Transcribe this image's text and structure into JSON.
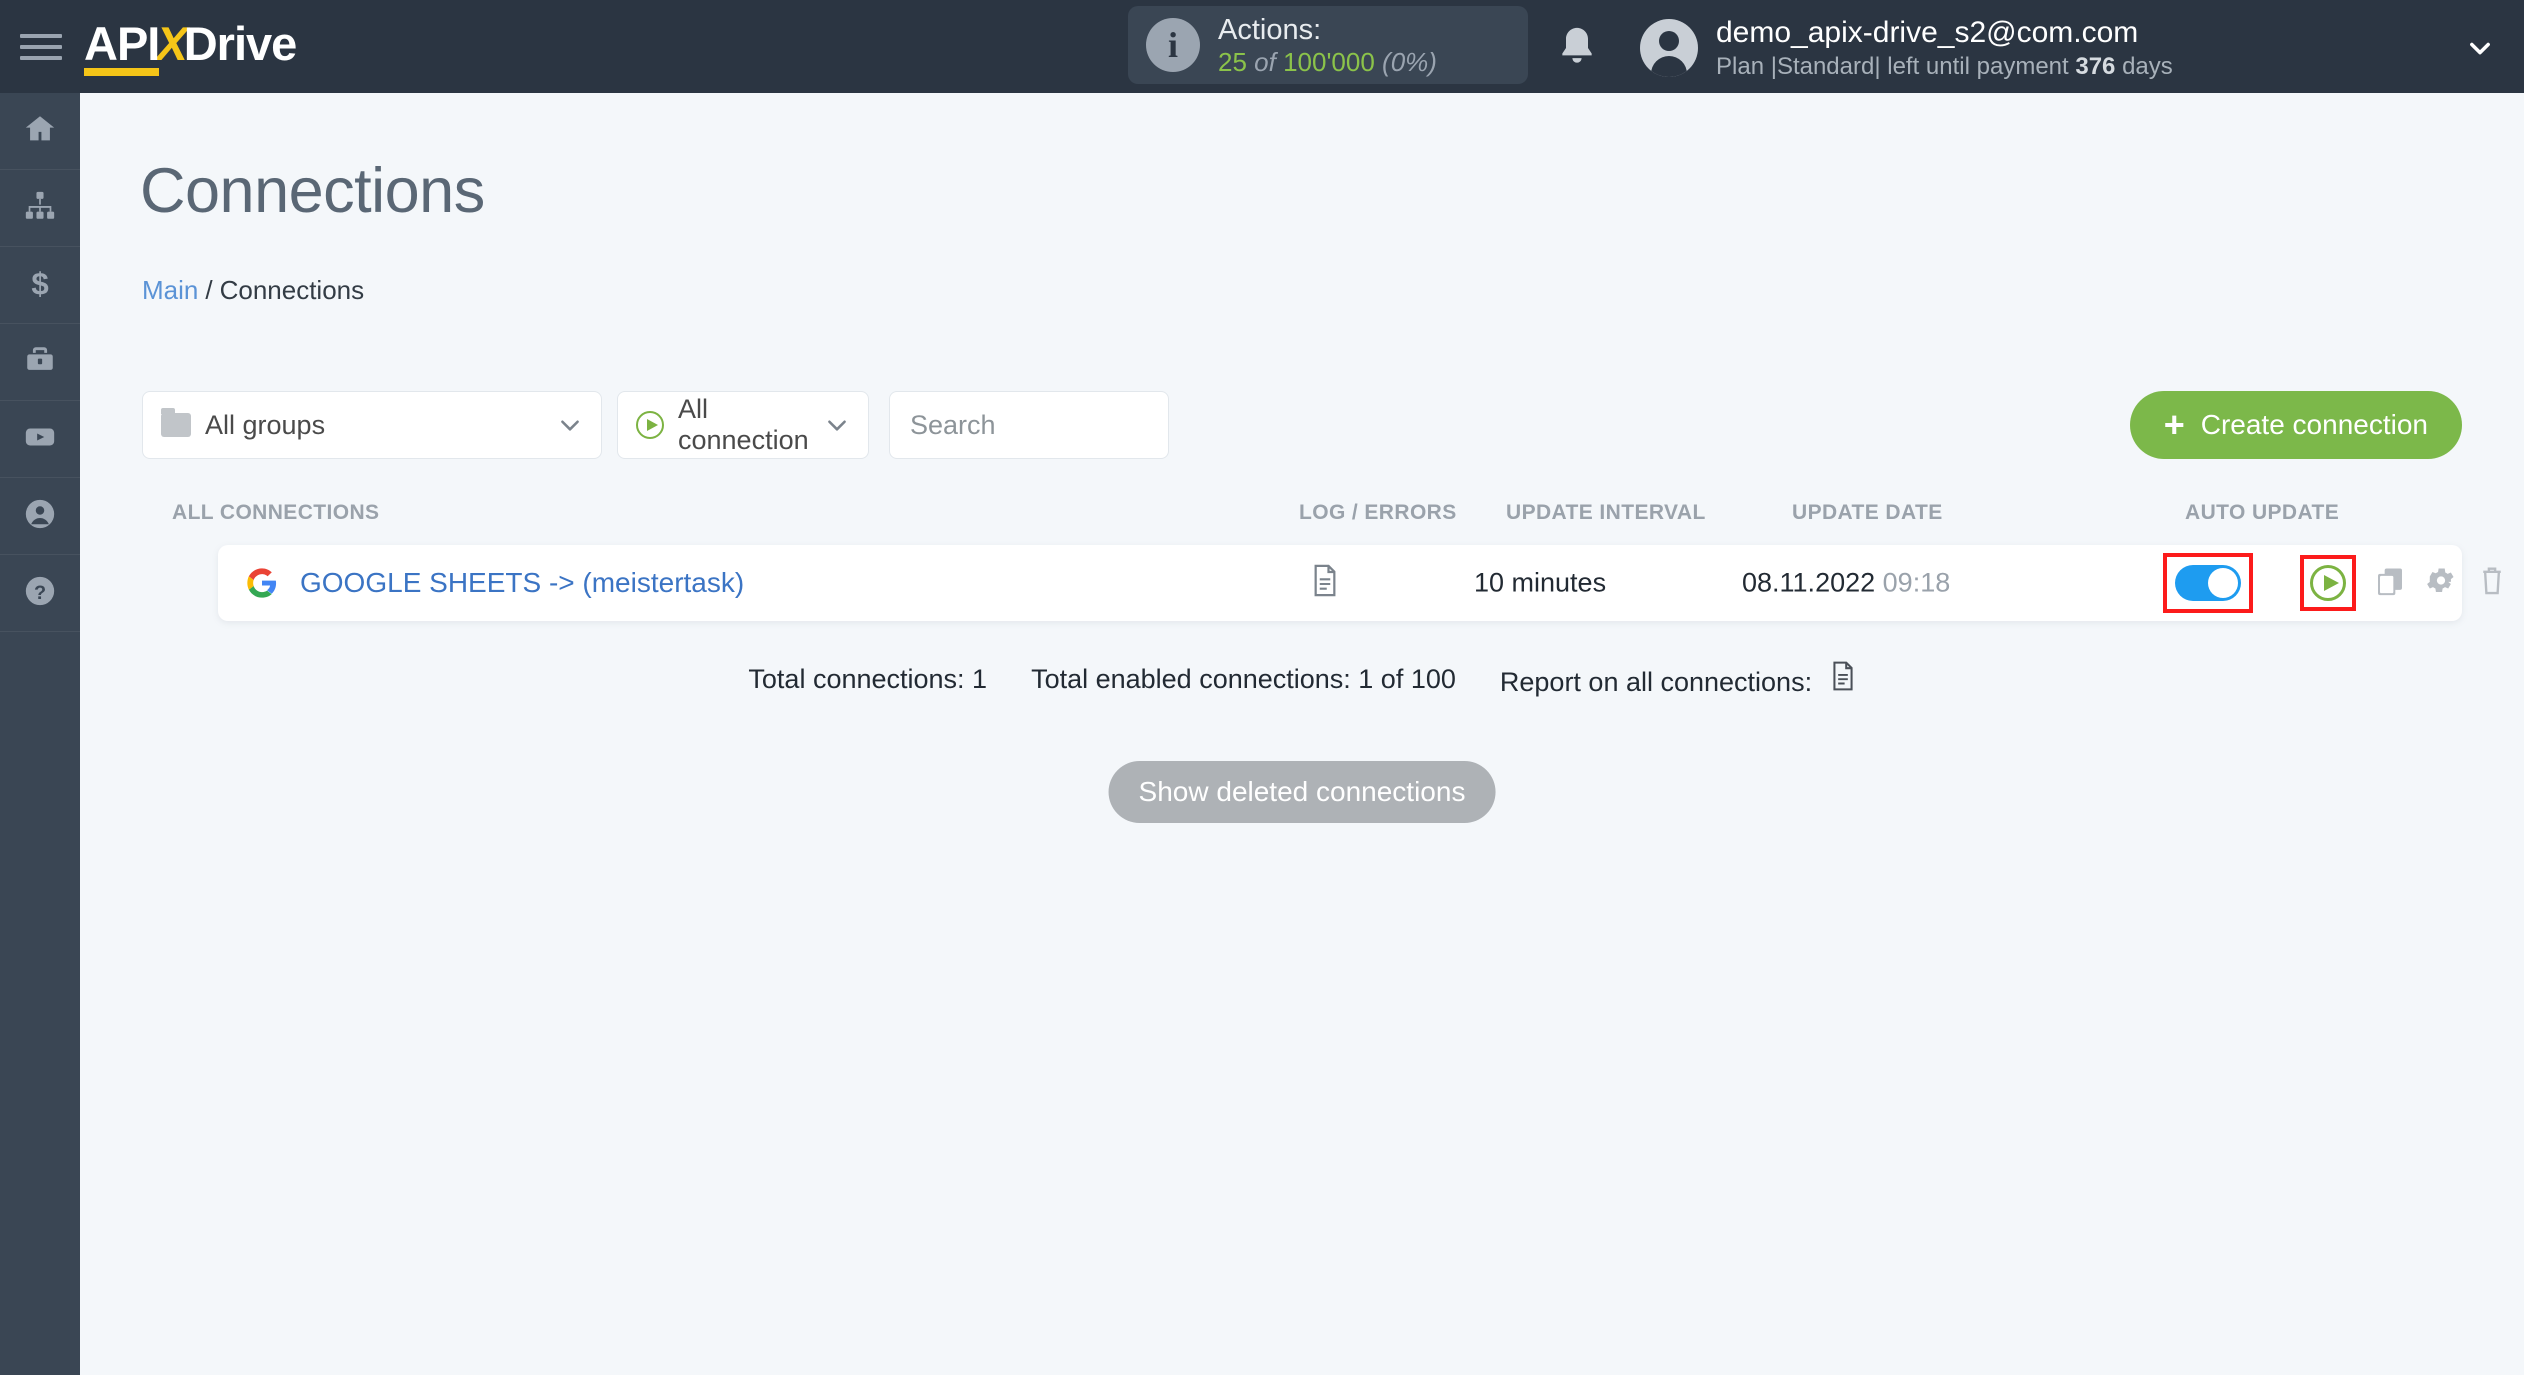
{
  "header": {
    "logo": {
      "part1": "API",
      "part2": "X",
      "part3": "Drive"
    },
    "menu_icon": "hamburger-icon",
    "actions": {
      "label": "Actions:",
      "used": "25",
      "of": "of",
      "total": "100'000",
      "percent": "(0%)"
    },
    "account": {
      "email": "demo_apix-drive_s2@com.com",
      "plan_prefix": "Plan |Standard| left until payment",
      "days_value": "376",
      "days_suffix": "days"
    }
  },
  "sidebar": {
    "items": [
      {
        "name": "home",
        "icon": "home-icon"
      },
      {
        "name": "connections",
        "icon": "sitemap-icon"
      },
      {
        "name": "billing",
        "icon": "dollar-icon"
      },
      {
        "name": "business",
        "icon": "briefcase-icon"
      },
      {
        "name": "video",
        "icon": "youtube-icon"
      },
      {
        "name": "account",
        "icon": "user-circle-icon"
      },
      {
        "name": "help",
        "icon": "question-circle-icon"
      }
    ]
  },
  "page": {
    "title": "Connections",
    "breadcrumb": {
      "root": "Main",
      "separator": "/",
      "current": "Connections"
    }
  },
  "filters": {
    "group_select": {
      "value": "All groups",
      "icon": "folder-icon"
    },
    "connection_select": {
      "value": "All connection",
      "icon": "play-circle-icon"
    },
    "search": {
      "placeholder": "Search",
      "value": ""
    },
    "create_button": {
      "label": "Create connection",
      "icon": "plus-icon"
    }
  },
  "table": {
    "columns": {
      "name": "ALL CONNECTIONS",
      "log": "LOG / ERRORS",
      "interval": "UPDATE INTERVAL",
      "date": "UPDATE DATE",
      "auto": "AUTO UPDATE"
    },
    "rows": [
      {
        "source_icon": "google-icon",
        "name": "GOOGLE SHEETS -> (meistertask)",
        "log_icon": "document-icon",
        "interval": "10 minutes",
        "date": "08.11.2022",
        "time": "09:18",
        "auto_update_enabled": true,
        "actions": [
          "run-icon",
          "copy-icon",
          "gear-icon",
          "trash-icon"
        ]
      }
    ]
  },
  "footer": {
    "total_connections": "Total connections: 1",
    "total_enabled": "Total enabled connections: 1 of 100",
    "report_label": "Report on all connections:",
    "report_icon": "document-icon",
    "show_deleted_label": "Show deleted connections"
  },
  "colors": {
    "topbar": "#2b3542",
    "sidebar": "#3a4654",
    "accent_green": "#7cb84a",
    "accent_yellow": "#f5c518",
    "link_blue": "#3b74c4",
    "toggle_blue": "#1e9cf0",
    "highlight_red": "#fc1b1b"
  }
}
